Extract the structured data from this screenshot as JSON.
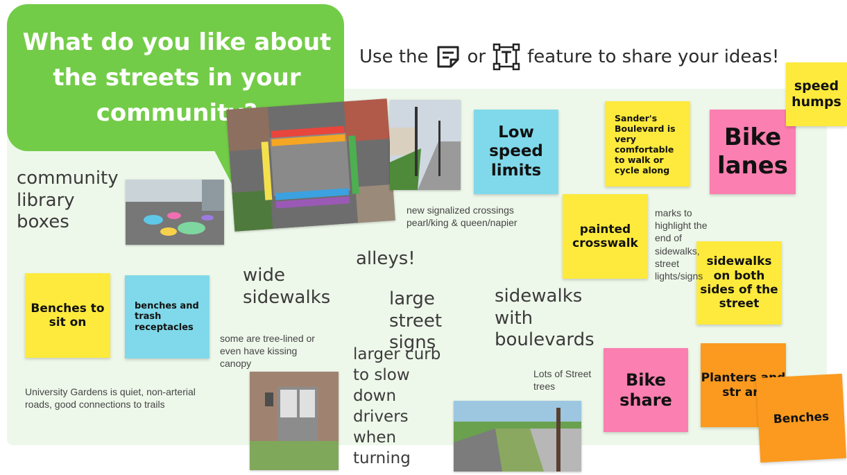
{
  "header": {
    "question": "What do you like about the streets in your community?",
    "instruction_prefix": "Use the",
    "instruction_or": "or",
    "instruction_suffix": "feature to share your ideas!",
    "sticky_icon": "sticky-note-icon",
    "text_icon": "text-tool-icon"
  },
  "stickies": {
    "low_speed": "Low speed limits",
    "sanders": "Sander's Boulevard is very comfortable to walk or cycle along",
    "bike_lanes": "Bike lanes",
    "speed_humps": "speed humps",
    "painted_crosswalk": "painted crosswalk",
    "sidewalks_both": "sidewalks on both sides of the street",
    "benches_sit": "Benches to sit on",
    "benches_trash": "benches and trash receptacles",
    "bike_share": "Bike share",
    "planters": "Planters and str art",
    "benches": "Benches"
  },
  "texts": {
    "library": "community library boxes",
    "crossings": "new signalized crossings pearl/king & queen/napier",
    "marks": "marks to highlight the end of sidewalks, street lights/signs",
    "alleys": "alleys!",
    "wide_sidewalks": "wide sidewalks",
    "large_signs": "large street signs",
    "boulevards": "sidewalks with boulevards",
    "tree_lined": "some are tree-lined or even have kissing canopy",
    "curb": "larger curb to slow down drivers when turning",
    "street_trees": "Lots of Street trees",
    "university": "University Gardens is quiet, non-arterial roads, good connections to trails"
  },
  "colors": {
    "bubble": "#73cc48",
    "board": "#eef8ea",
    "yellow": "#fdea3c",
    "cyan": "#7fd9ea",
    "pink": "#fb7fb0",
    "orange": "#fb9a1e"
  }
}
